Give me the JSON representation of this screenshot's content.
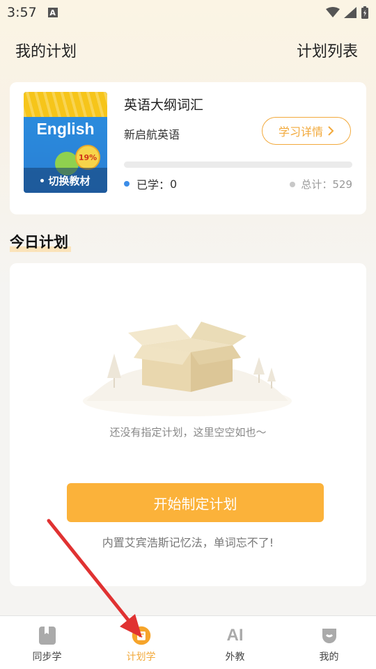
{
  "status_bar": {
    "time": "3:57",
    "notification_letter": "A"
  },
  "header": {
    "title": "我的计划",
    "plan_list_link": "计划列表"
  },
  "book": {
    "cover_title": "English",
    "cover_badge": "19%",
    "cover_switch_label": "切换教材",
    "name": "英语大纲词汇",
    "publisher": "新启航英语",
    "detail_button": "学习详情",
    "progress_fraction": 0,
    "learned_label": "已学：",
    "learned_count": "0",
    "total_label": "总计：",
    "total_count": "529"
  },
  "today_plan": {
    "title": "今日计划",
    "empty_text": "还没有指定计划，这里空空如也～",
    "start_button": "开始制定计划",
    "tip": "内置艾宾浩斯记忆法，单词忘不了!"
  },
  "tabbar": {
    "items": [
      {
        "label": "同步学",
        "icon": "book-icon"
      },
      {
        "label": "计划学",
        "icon": "plan-icon",
        "active": true
      },
      {
        "label": "外教",
        "icon": "ai-icon",
        "icon_text": "AI"
      },
      {
        "label": "我的",
        "icon": "profile-icon"
      }
    ]
  },
  "colors": {
    "accent": "#f2a93b",
    "learned_dot": "#3b8de8",
    "arrow": "#e03232"
  }
}
